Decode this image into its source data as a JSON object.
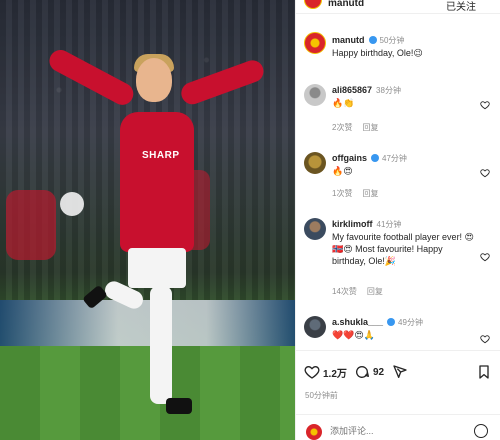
{
  "post": {
    "account": "manutd",
    "follow_label": "已关注",
    "image_alt": "",
    "sponsor_text": "SHARP"
  },
  "caption": {
    "user": "manutd",
    "time": "50分钟",
    "text": "Happy birthday, Ole!😉"
  },
  "comments": [
    {
      "user": "ali865867",
      "verified": false,
      "time": "38分钟",
      "text": "🔥👏",
      "likes": "2次赞",
      "reply": "回复"
    },
    {
      "user": "offgains",
      "verified": true,
      "time": "47分钟",
      "text": "🔥😍",
      "likes": "1次赞",
      "reply": "回复"
    },
    {
      "user": "kirklimoff",
      "verified": false,
      "time": "41分钟",
      "text": "My favourite football player ever! 😍🇳🇴😍 Most favourite! Happy birthday, Ole!🎉",
      "likes": "14次赞",
      "reply": "回复"
    },
    {
      "user": "a.shukla___",
      "verified": true,
      "time": "49分钟",
      "text": "❤️❤️😍🙏",
      "likes": "",
      "reply": ""
    }
  ],
  "actions": {
    "likes_count": "1.2万",
    "comments_count": "92",
    "like_icon": "heart-icon",
    "comment_icon": "comment-icon",
    "share_icon": "send-icon",
    "save_icon": "bookmark-icon"
  },
  "post_time": "50分钟前",
  "add_comment": {
    "placeholder": "添加评论..."
  },
  "colors": {
    "jersey_red": "#c8102e",
    "verified_blue": "#3897f0",
    "muted": "#8e8e8e"
  }
}
